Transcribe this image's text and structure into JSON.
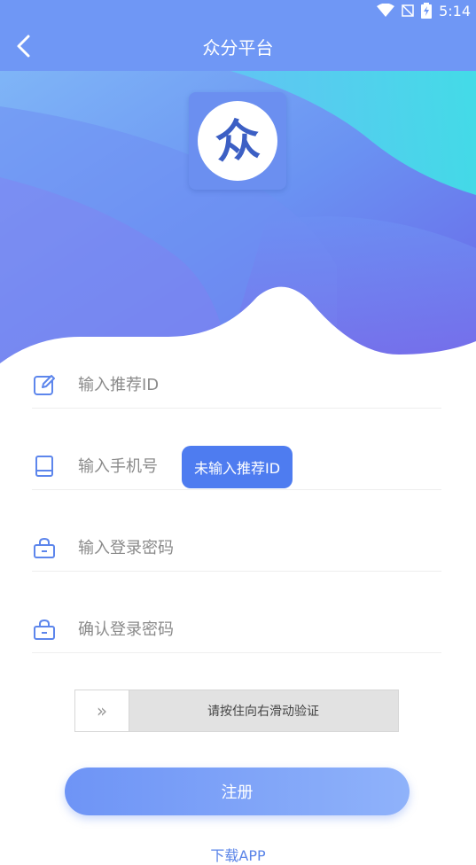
{
  "status": {
    "time": "5:14"
  },
  "nav": {
    "title": "众分平台"
  },
  "logo": {
    "glyph": "众"
  },
  "form": {
    "referral_placeholder": "输入推荐ID",
    "phone_placeholder": "输入手机号",
    "password_placeholder": "输入登录密码",
    "confirm_placeholder": "确认登录密码"
  },
  "toast": {
    "text": "未输入推荐ID"
  },
  "slider": {
    "handle": "»",
    "text": "请按住向右滑动验证"
  },
  "actions": {
    "register": "注册",
    "download": "下载APP"
  },
  "colors": {
    "primary": "#6f97f5",
    "accent": "#4e7cf0",
    "link": "#5a84e8"
  }
}
